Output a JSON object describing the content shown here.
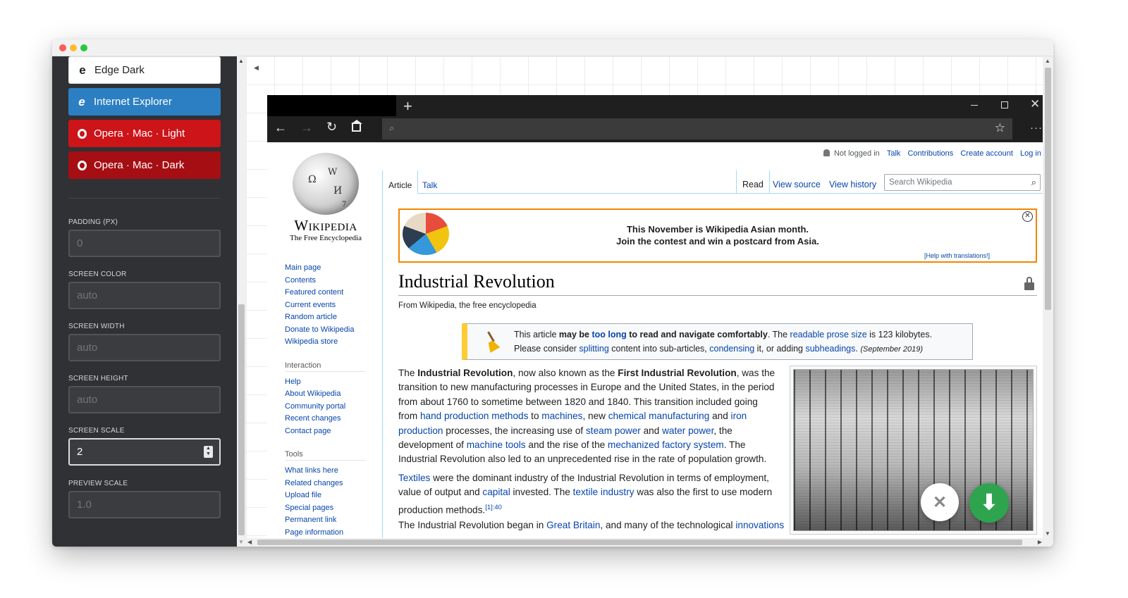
{
  "themes": [
    {
      "label": "Edge Dark",
      "style": "light",
      "icon": "edge-icon"
    },
    {
      "label": "Internet Explorer",
      "style": "ie",
      "icon": "ie-icon"
    },
    {
      "label": "Opera · Mac · Light",
      "style": "opera",
      "icon": "opera-icon"
    },
    {
      "label": "Opera · Mac · Dark",
      "style": "opera-dark",
      "icon": "opera-icon"
    }
  ],
  "fields": {
    "padding": {
      "label": "PADDING (PX)",
      "placeholder": "0"
    },
    "screen_color": {
      "label": "SCREEN COLOR",
      "placeholder": "auto"
    },
    "screen_width": {
      "label": "SCREEN WIDTH",
      "placeholder": "auto"
    },
    "screen_height": {
      "label": "SCREEN HEIGHT",
      "placeholder": "auto"
    },
    "screen_scale": {
      "label": "SCREEN SCALE",
      "value": "2"
    },
    "preview_scale": {
      "label": "PREVIEW SCALE",
      "placeholder": "1.0"
    }
  },
  "colors": {
    "ie_blue": "#2c7fc2",
    "opera_red": "#cc1419",
    "opera_dark_red": "#a50f14",
    "panel_bg": "#2f3135",
    "wiki_link": "#0645ad",
    "download_green": "#2ea44f"
  },
  "browser": {
    "new_tab": "+",
    "omnibox_placeholder": ""
  },
  "wiki": {
    "logo_title": "Wikipedia",
    "logo_sub": "The Free Encyclopedia",
    "user": {
      "not_logged": "Not logged in",
      "talk": "Talk",
      "contributions": "Contributions",
      "create": "Create account",
      "login": "Log in"
    },
    "tabs_left": [
      "Article",
      "Talk"
    ],
    "tabs_right": [
      "Read",
      "View source",
      "View history"
    ],
    "search_placeholder": "Search Wikipedia",
    "banner": {
      "line1": "This November is Wikipedia Asian month.",
      "line2": "Join the contest and win a postcard from Asia.",
      "help": "[Help with translations!]"
    },
    "title": "Industrial Revolution",
    "from": "From Wikipedia, the free encyclopedia",
    "notice": {
      "p1": "This article ",
      "b1": "may be ",
      "l1": "too long",
      "b2": " to read and navigate comfortably",
      "p2": ". The ",
      "l2": "readable prose size",
      "p3": " is 123 kilobytes.",
      "p4": "Please consider ",
      "l3": "splitting",
      "p5": " content into sub-articles, ",
      "l4": "condensing",
      "p6": " it, or adding ",
      "l5": "subheadings",
      "p7": ". ",
      "date": "(September 2019)"
    },
    "nav_main": [
      "Main page",
      "Contents",
      "Featured content",
      "Current events",
      "Random article",
      "Donate to Wikipedia",
      "Wikipedia store"
    ],
    "nav_interaction_title": "Interaction",
    "nav_interaction": [
      "Help",
      "About Wikipedia",
      "Community portal",
      "Recent changes",
      "Contact page"
    ],
    "nav_tools_title": "Tools",
    "nav_tools": [
      "What links here",
      "Related changes",
      "Upload file",
      "Special pages",
      "Permanent link",
      "Page information"
    ],
    "p1": {
      "t1": "The ",
      "b1": "Industrial Revolution",
      "t2": ", now also known as the ",
      "b2": "First Industrial Revolution",
      "t3": ", was the transition to new manufacturing processes in Europe and the United States, in the period from about 1760 to sometime between 1820 and 1840. This transition included going from ",
      "l1": "hand production methods",
      "t4": " to ",
      "l2": "machines",
      "t5": ", new ",
      "l3": "chemical manufacturing",
      "t6": " and ",
      "l4": "iron production",
      "t7": " processes, the increasing use of ",
      "l5": "steam power",
      "t8": " and ",
      "l6": "water power",
      "t9": ", the development of ",
      "l7": "machine tools",
      "t10": " and the rise of the ",
      "l8": "mechanized factory system",
      "t11": ". The Industrial Revolution also led to an unprecedented rise in the rate of population growth."
    },
    "p2": {
      "l1": "Textiles",
      "t1": " were the dominant industry of the Industrial Revolution in terms of employment, value of output and ",
      "l2": "capital",
      "t2": " invested. The ",
      "l3": "textile industry",
      "t3": " was also the first to use modern production methods.",
      "ref": "[1]:40"
    },
    "p3": {
      "t1": "The Industrial Revolution began in ",
      "l1": "Great Britain",
      "t2": ", and many of the technological ",
      "l2": "innovations"
    }
  }
}
